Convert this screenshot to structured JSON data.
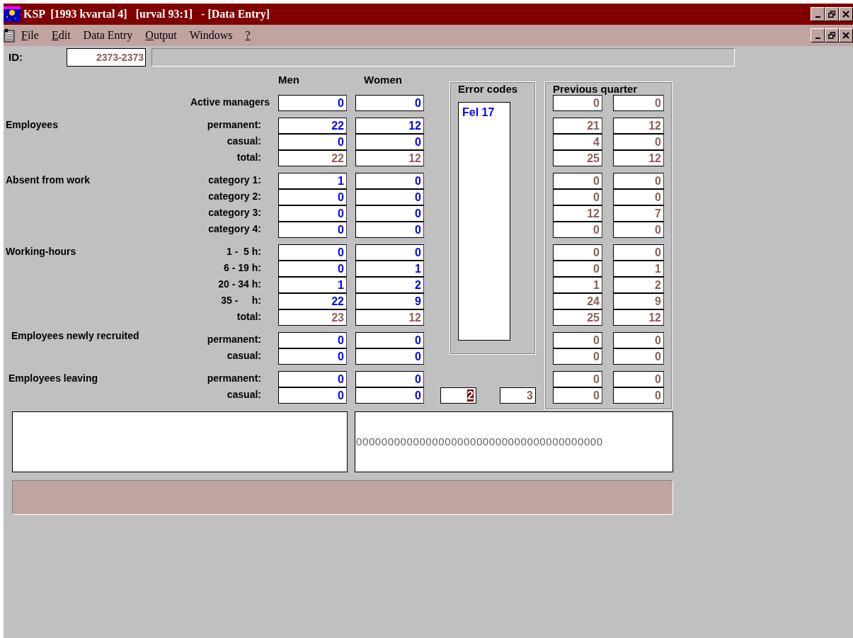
{
  "window": {
    "title": "KSP  [1993 kvartal 4]   [urval 93:1]   - [Data Entry]"
  },
  "menu": [
    {
      "label": "File",
      "mnemonic": true
    },
    {
      "label": "Edit",
      "mnemonic": true
    },
    {
      "label": "Data Entry",
      "mnemonic": false
    },
    {
      "label": "Output",
      "mnemonic": true
    },
    {
      "label": "Windows",
      "mnemonic": false
    },
    {
      "label": "?",
      "mnemonic": true
    }
  ],
  "id_row": {
    "label": "ID:",
    "value": "2373-2373"
  },
  "columns": [
    "Men",
    "Women"
  ],
  "sections": [
    {
      "rows": [
        {
          "label": "Active managers",
          "men": {
            "value": "0",
            "kind": "entry"
          },
          "women": {
            "value": "0",
            "kind": "entry"
          },
          "prev_men": "0",
          "prev_women": "0"
        }
      ]
    },
    {
      "label": "Employees",
      "rows": [
        {
          "label": "permanent:",
          "men": {
            "value": "22",
            "kind": "entry"
          },
          "women": {
            "value": "12",
            "kind": "entry"
          },
          "prev_men": "21",
          "prev_women": "12"
        },
        {
          "label": "casual:",
          "men": {
            "value": "0",
            "kind": "entry"
          },
          "women": {
            "value": "0",
            "kind": "entry"
          },
          "prev_men": "4",
          "prev_women": "0"
        },
        {
          "label": "total:",
          "men": {
            "value": "22",
            "kind": "calc"
          },
          "women": {
            "value": "12",
            "kind": "calc"
          },
          "prev_men": "25",
          "prev_women": "12"
        }
      ]
    },
    {
      "label": "Absent from work",
      "rows": [
        {
          "label": "category 1:",
          "men": {
            "value": "1",
            "kind": "entry"
          },
          "women": {
            "value": "0",
            "kind": "entry"
          },
          "prev_men": "0",
          "prev_women": "0"
        },
        {
          "label": "category 2:",
          "men": {
            "value": "0",
            "kind": "entry"
          },
          "women": {
            "value": "0",
            "kind": "entry"
          },
          "prev_men": "0",
          "prev_women": "0"
        },
        {
          "label": "category 3:",
          "men": {
            "value": "0",
            "kind": "entry"
          },
          "women": {
            "value": "0",
            "kind": "entry"
          },
          "prev_men": "12",
          "prev_women": "7"
        },
        {
          "label": "category 4:",
          "men": {
            "value": "0",
            "kind": "entry"
          },
          "women": {
            "value": "0",
            "kind": "entry"
          },
          "prev_men": "0",
          "prev_women": "0"
        }
      ]
    },
    {
      "label": "Working-hours",
      "rows": [
        {
          "label": "1 -  5 h:",
          "men": {
            "value": "0",
            "kind": "entry"
          },
          "women": {
            "value": "0",
            "kind": "entry"
          },
          "prev_men": "0",
          "prev_women": "0"
        },
        {
          "label": "6 - 19 h:",
          "men": {
            "value": "0",
            "kind": "entry"
          },
          "women": {
            "value": "1",
            "kind": "entry"
          },
          "prev_men": "0",
          "prev_women": "1"
        },
        {
          "label": "20 - 34 h:",
          "men": {
            "value": "1",
            "kind": "entry"
          },
          "women": {
            "value": "2",
            "kind": "entry"
          },
          "prev_men": "1",
          "prev_women": "2"
        },
        {
          "label": "35 -     h:",
          "men": {
            "value": "22",
            "kind": "entry"
          },
          "women": {
            "value": "9",
            "kind": "entry"
          },
          "prev_men": "24",
          "prev_women": "9"
        },
        {
          "label": "total:",
          "men": {
            "value": "23",
            "kind": "calc"
          },
          "women": {
            "value": "12",
            "kind": "calc"
          },
          "prev_men": "25",
          "prev_women": "12"
        }
      ]
    },
    {
      "label": "Employees newly recruited",
      "rows": [
        {
          "label": "permanent:",
          "men": {
            "value": "0",
            "kind": "entry"
          },
          "women": {
            "value": "0",
            "kind": "entry"
          },
          "prev_men": "0",
          "prev_women": "0"
        },
        {
          "label": "casual:",
          "men": {
            "value": "0",
            "kind": "entry"
          },
          "women": {
            "value": "0",
            "kind": "entry"
          },
          "prev_men": "0",
          "prev_women": "0"
        }
      ]
    },
    {
      "label": "Employees leaving",
      "rows": [
        {
          "label": "permanent:",
          "men": {
            "value": "0",
            "kind": "entry"
          },
          "women": {
            "value": "0",
            "kind": "entry"
          },
          "prev_men": "0",
          "prev_women": "0"
        },
        {
          "label": "casual:",
          "men": {
            "value": "0",
            "kind": "entry"
          },
          "women": {
            "value": "0",
            "kind": "entry"
          },
          "prev_men": "0",
          "prev_women": "0"
        }
      ]
    }
  ],
  "error_codes": {
    "title": "Error codes",
    "items": [
      "Fel 17"
    ]
  },
  "counters": [
    {
      "value": "2",
      "highlighted": true
    },
    {
      "value": "3",
      "highlighted": false
    }
  ],
  "previous_quarter": {
    "title": "Previous quarter"
  },
  "code_field": "000000000000000000000000000000000000000"
}
